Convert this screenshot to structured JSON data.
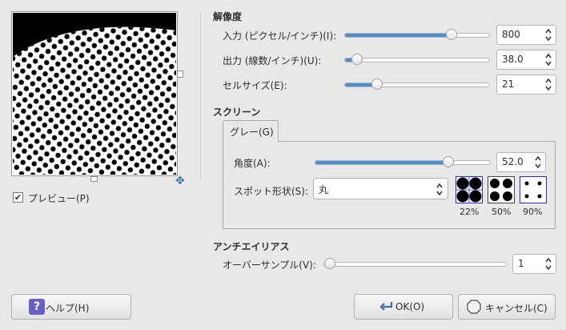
{
  "preview": {
    "checkbox_label": "プレビュー(P)",
    "checked": true
  },
  "resolution": {
    "header": "解像度",
    "rows": [
      {
        "label": "入力 (ピクセル/インチ)(I):",
        "value": "800",
        "level": 0.76
      },
      {
        "label": "出力 (線数/インチ)(U):",
        "value": "38.0",
        "level": 0.05
      },
      {
        "label": "セルサイズ(E):",
        "value": "21",
        "level": 0.2
      }
    ]
  },
  "screen": {
    "header": "スクリーン",
    "tab": "グレー(G)",
    "angle": {
      "label": "角度(A):",
      "value": "52.0",
      "level": 0.78
    },
    "spot": {
      "label": "スポット形状(S):",
      "value": "丸"
    },
    "swatches": [
      "22%",
      "50%",
      "90%"
    ]
  },
  "antialias": {
    "header": "アンチエイリアス",
    "label": "オーバーサンプル(V):",
    "value": "1",
    "level": 0.0
  },
  "buttons": {
    "help": "ヘルプ(H)",
    "ok": "OK(O)",
    "cancel": "キャンセル(C)"
  },
  "colors": {
    "accent": "#4a90d9",
    "help_icon": "#6a5fc4"
  }
}
